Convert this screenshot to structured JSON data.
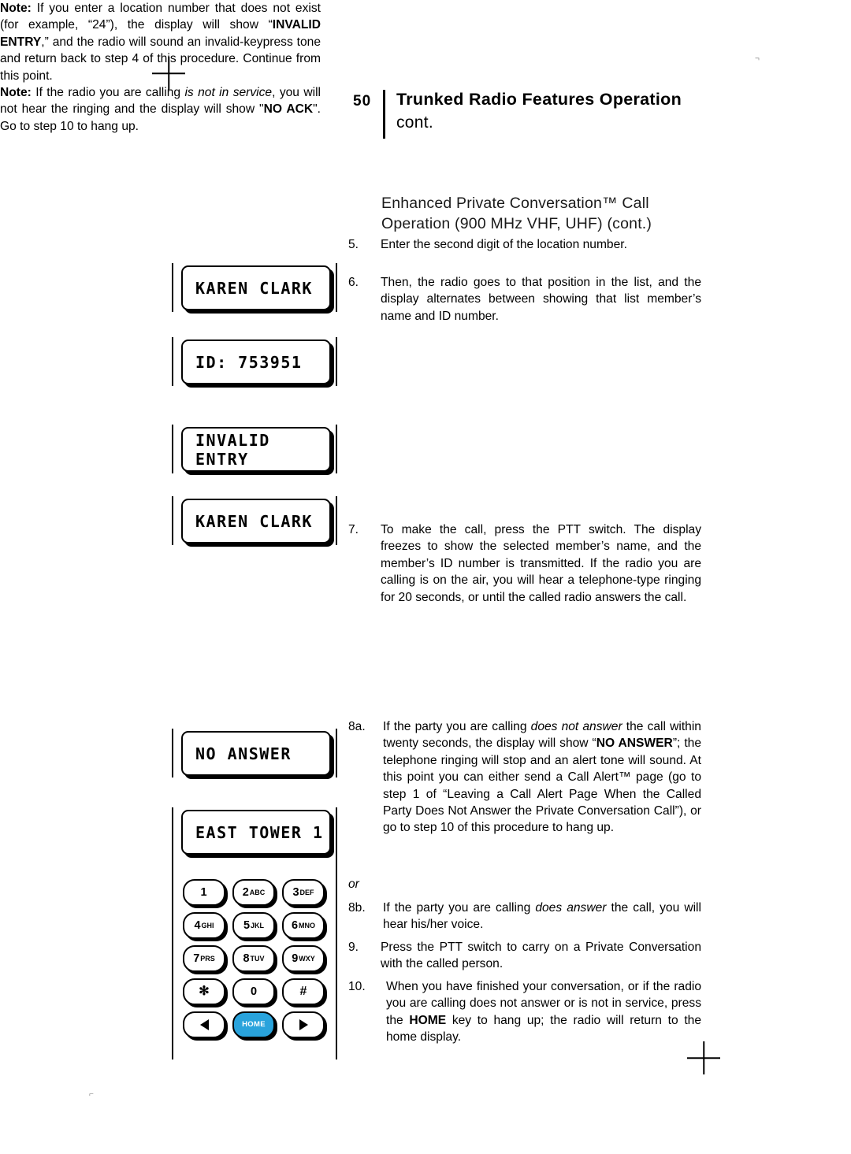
{
  "header": {
    "page_number": "50",
    "title": "Trunked Radio Features Operation",
    "continued": "cont."
  },
  "section": {
    "line1": "Enhanced Private Conversation™ Call",
    "line2": "Operation (900 MHz VHF, UHF) (cont.)"
  },
  "steps": {
    "s5_num": "5.",
    "s5_text": "Enter the second digit of the location number.",
    "s6_num": "6.",
    "s6_text": "Then, the radio goes to that position in the list, and the display alternates between showing that list member’s name and ID number.",
    "note1_label": "Note:",
    "note1_a": " If you enter a location number that does not exist (for example, “24”), the display will show “",
    "note1_bold": "INVALID ENTRY",
    "note1_b": ",” and the radio will sound an invalid-keypress tone and return back to step 4 of this procedure. Continue from this point.",
    "s7_num": "7.",
    "s7_text": "To make the call, press the PTT switch. The display freezes to show the selected member’s name, and the member’s ID number is transmitted. If the radio you are calling is on the air, you will hear a telephone-type ringing for 20 seconds, or until the called radio answers the call.",
    "note2_label": "Note:",
    "note2_a": " If the radio you are calling ",
    "note2_ital": "is not in service",
    "note2_b": ", you will not hear the ringing and the display will show \"",
    "note2_bold": "NO ACK",
    "note2_c": "\". Go to step 10 to hang up.",
    "s8a_num": "8a.",
    "s8a_a": "If the party you are calling ",
    "s8a_ital": "does not answer",
    "s8a_b": " the call within twenty seconds, the display will show “",
    "s8a_bold": "NO ANSWER",
    "s8a_c": "”; the telephone ringing will stop and an alert tone will sound. At this point you can either send a Call Alert™ page (go to step 1 of “Leaving a Call Alert Page When the Called Party Does Not Answer the Private Conversation Call”), or go to step 10 of this procedure to hang up.",
    "or": "or",
    "s8b_num": "8b.",
    "s8b_a": "If the party you are calling ",
    "s8b_ital": "does answer",
    "s8b_b": " the call, you will hear his/her voice.",
    "s9_num": "9.",
    "s9_text": "Press the PTT switch to carry on a Private Conversation with the called person.",
    "s10_num": "10.",
    "s10_a": "When you have finished your conversation, or if the radio you are calling does not answer or is not in service, press the ",
    "s10_bold": "HOME",
    "s10_b": " key to hang up; the radio will return to the home display."
  },
  "displays": [
    {
      "name": "display-karen-clark-1",
      "text": "KAREN CLARK"
    },
    {
      "name": "display-id-number",
      "text": "ID: 753951"
    },
    {
      "name": "display-invalid-entry",
      "text": "INVALID ENTRY"
    },
    {
      "name": "display-karen-clark-2",
      "text": "KAREN CLARK"
    },
    {
      "name": "display-no-answer",
      "text": "NO ANSWER"
    },
    {
      "name": "display-east-tower",
      "text": "EAST TOWER 1"
    }
  ],
  "keypad": {
    "rows": [
      [
        {
          "name": "key-1",
          "big": "1",
          "small": ""
        },
        {
          "name": "key-2",
          "big": "2",
          "small": "ABC"
        },
        {
          "name": "key-3",
          "big": "3",
          "small": "DEF"
        }
      ],
      [
        {
          "name": "key-4",
          "big": "4",
          "small": "GHI"
        },
        {
          "name": "key-5",
          "big": "5",
          "small": "JKL"
        },
        {
          "name": "key-6",
          "big": "6",
          "small": "MNO"
        }
      ],
      [
        {
          "name": "key-7",
          "big": "7",
          "small": "PRS"
        },
        {
          "name": "key-8",
          "big": "8",
          "small": "TUV"
        },
        {
          "name": "key-9",
          "big": "9",
          "small": "WXY"
        }
      ],
      [
        {
          "name": "key-star",
          "big": "✻",
          "small": ""
        },
        {
          "name": "key-0",
          "big": "0",
          "small": ""
        },
        {
          "name": "key-pound",
          "big": "#",
          "small": ""
        }
      ]
    ],
    "nav": {
      "left_label": "left-arrow-icon",
      "home_label": "HOME",
      "right_label": "right-arrow-icon"
    },
    "home_color": "#29a3dc"
  }
}
